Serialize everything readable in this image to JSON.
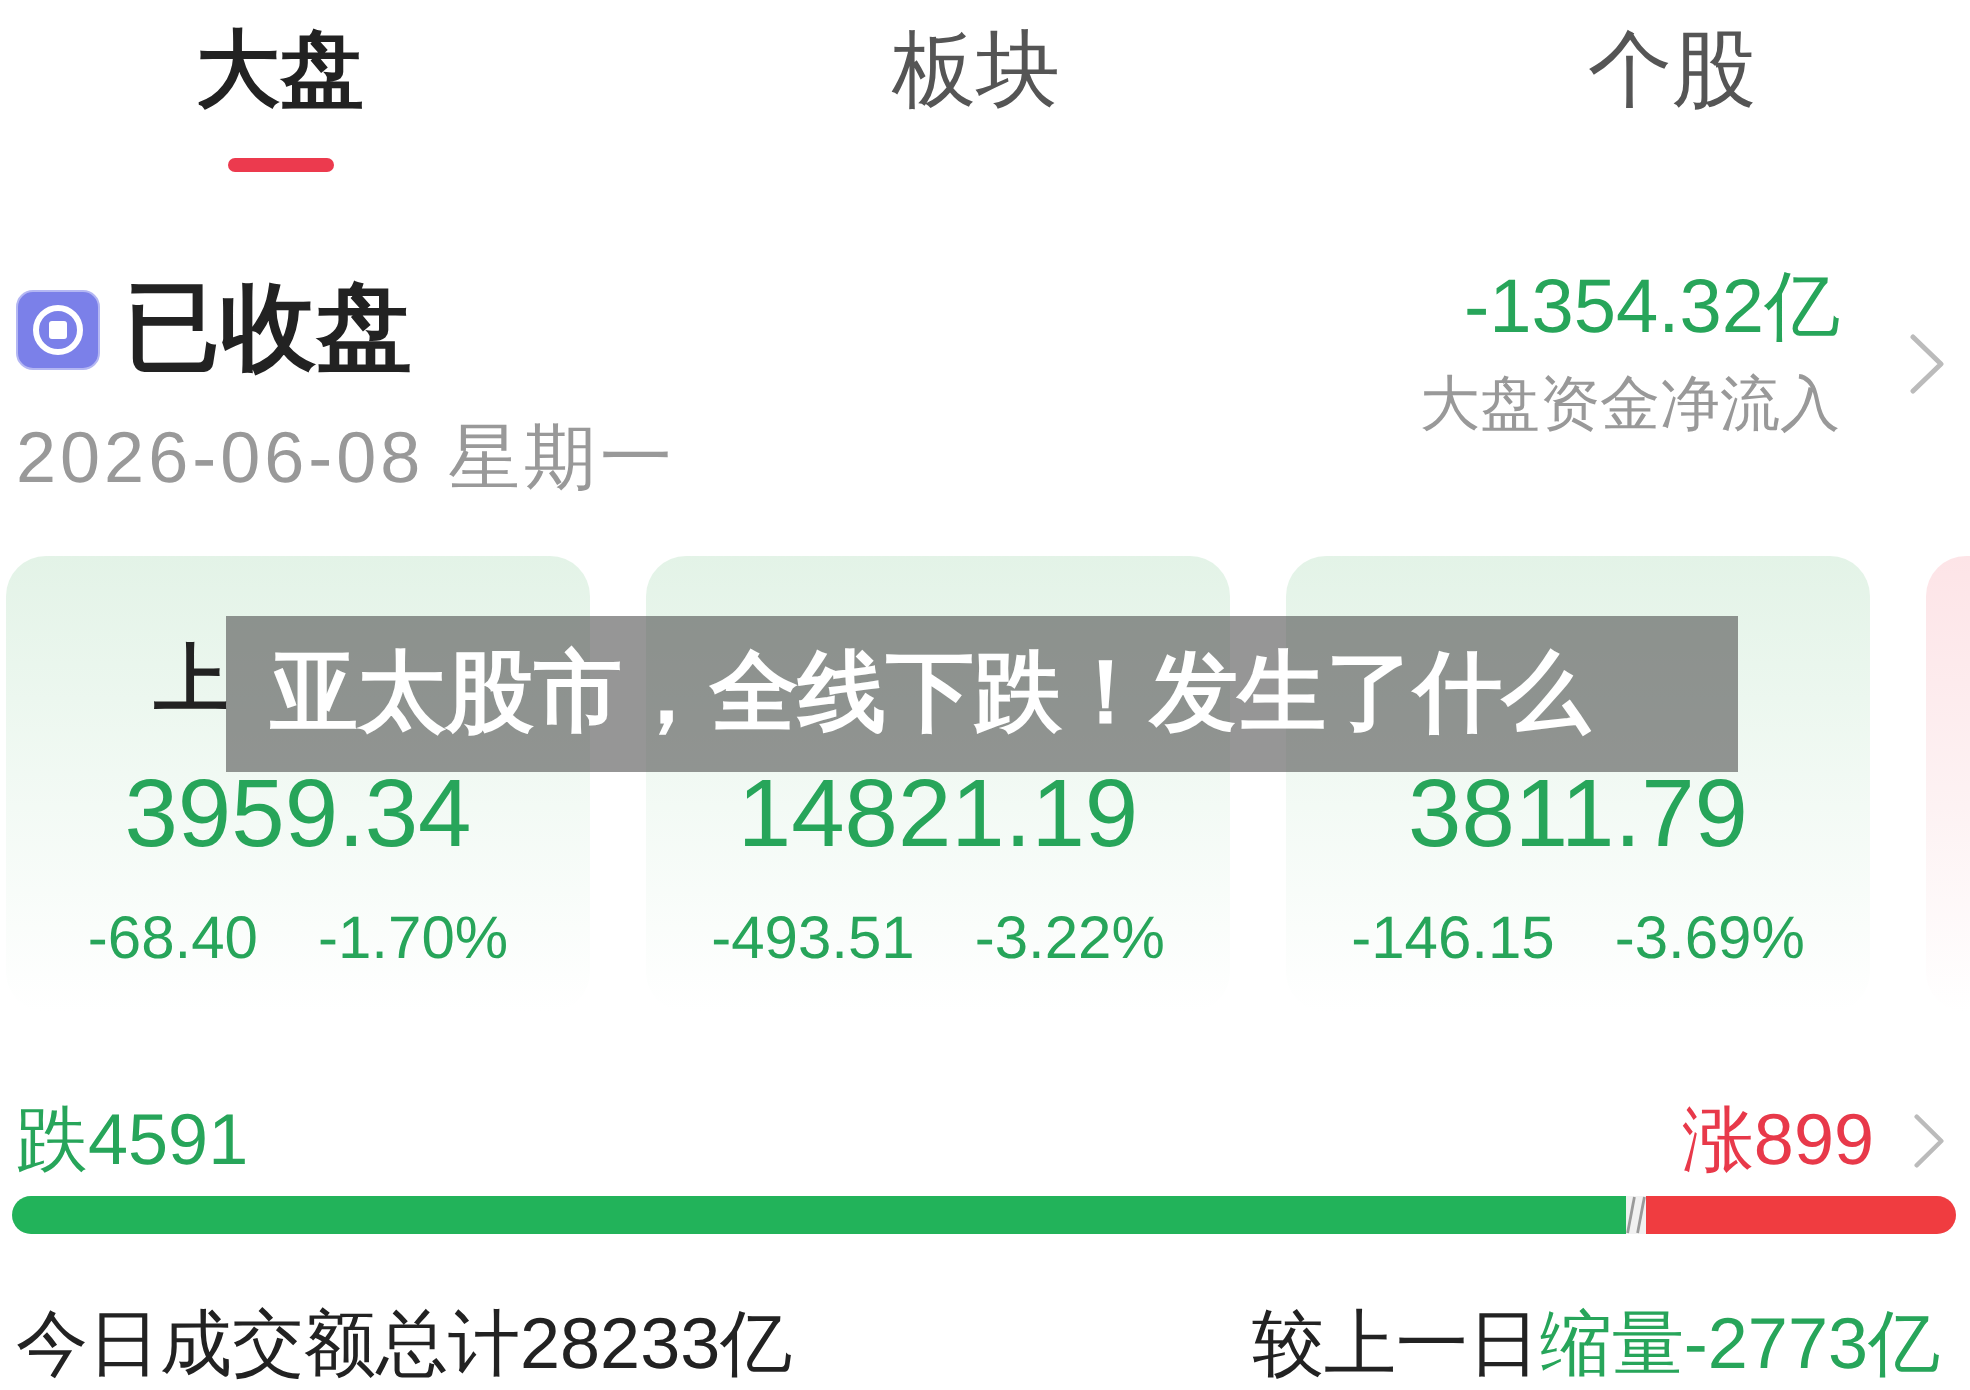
{
  "tabs": [
    {
      "label": "大盘",
      "selected": true
    },
    {
      "label": "板块",
      "selected": false
    },
    {
      "label": "个股",
      "selected": false
    }
  ],
  "market_status": {
    "title": "已收盘",
    "date": "2026-06-08 星期一",
    "net_flow": "-1354.32亿",
    "net_flow_rising": false,
    "net_flow_label": "大盘资金净流入"
  },
  "index_cards": [
    {
      "name": "上",
      "value": "3959.34",
      "change": "-68.40",
      "change_pct": "-1.70%",
      "rising": false
    },
    {
      "value": "14821.19",
      "change": "-493.51",
      "change_pct": "-3.22%",
      "rising": false
    },
    {
      "value": "3811.79",
      "change": "-146.15",
      "change_pct": "-3.69%",
      "rising": false
    },
    {
      "rising": true
    }
  ],
  "headline_banner": {
    "text": "亚太股市，全线下跌！发生了什么"
  },
  "breadth": {
    "down": "跌4591",
    "up": "涨899",
    "level": 0.83
  },
  "turnover": {
    "total": "今日成交额总计28233亿",
    "compare_label": "较上一日",
    "compare_value": "缩量-2773亿",
    "compare_rising": false
  }
}
